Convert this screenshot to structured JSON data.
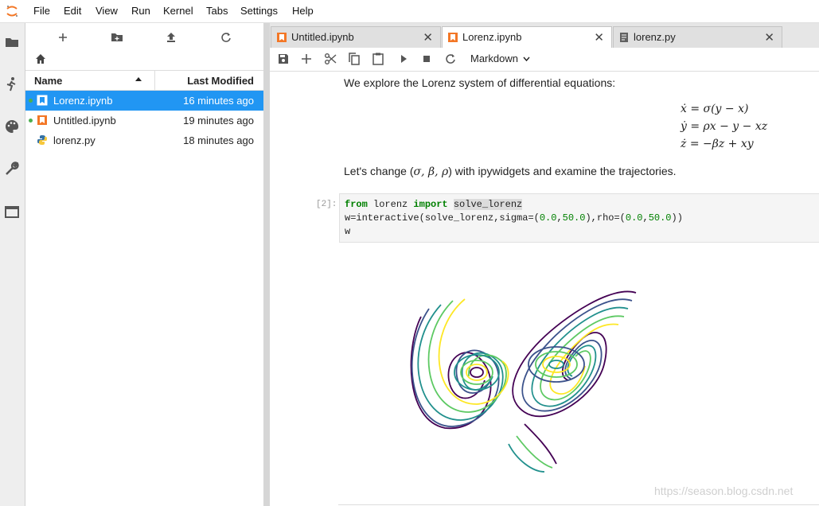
{
  "menu": [
    "File",
    "Edit",
    "View",
    "Run",
    "Kernel",
    "Tabs",
    "Settings",
    "Help"
  ],
  "sidebar_icons": [
    "folder-icon",
    "running-icon",
    "palette-icon",
    "wrench-icon",
    "tabs-icon"
  ],
  "file_browser": {
    "toolbar": [
      "new-launcher-icon",
      "new-folder-icon",
      "upload-icon",
      "refresh-icon"
    ],
    "columns": {
      "name": "Name",
      "modified": "Last Modified"
    },
    "files": [
      {
        "name": "Lorenz.ipynb",
        "modified": "16 minutes ago",
        "type": "notebook",
        "running": true,
        "selected": true
      },
      {
        "name": "Untitled.ipynb",
        "modified": "19 minutes ago",
        "type": "notebook",
        "running": true,
        "selected": false
      },
      {
        "name": "lorenz.py",
        "modified": "18 minutes ago",
        "type": "python",
        "running": false,
        "selected": false
      }
    ]
  },
  "tabs": [
    {
      "label": "Untitled.ipynb",
      "type": "notebook",
      "active": false
    },
    {
      "label": "Lorenz.ipynb",
      "type": "notebook",
      "active": true
    },
    {
      "label": "lorenz.py",
      "type": "file",
      "active": false
    }
  ],
  "notebook_toolbar": {
    "buttons": [
      "save-icon",
      "add-cell-icon",
      "cut-icon",
      "copy-icon",
      "paste-icon",
      "run-icon",
      "stop-icon",
      "restart-icon"
    ],
    "cell_type": "Markdown"
  },
  "notebook": {
    "intro": "We explore the Lorenz system of differential equations:",
    "equations": [
      "ẋ = σ(y − x)",
      "ẏ = ρx − y − xz",
      "ż = −βz + xy"
    ],
    "change_text_before": "Let's change (",
    "change_params": "σ, β, ρ",
    "change_text_after": ") with ipywidgets and examine the trajectories.",
    "code_prompt": "[2]:",
    "code": {
      "line1_kw1": "from",
      "line1_mod": " lorenz ",
      "line1_kw2": "import",
      "line1_name": "solve_lorenz",
      "line2_a": "w=interactive(solve_lorenz,sigma=(",
      "line2_n1": "0.0",
      "line2_b": ",",
      "line2_n2": "50.0",
      "line2_c": "),rho=(",
      "line2_n3": "0.0",
      "line2_d": ",",
      "line2_n4": "50.0",
      "line2_e": "))",
      "line3": "w"
    }
  },
  "colors": {
    "accent": "#2196f3",
    "notebook_icon": "#f37726",
    "running": "#4caf50"
  },
  "watermark": "https://season.blog.csdn.net"
}
